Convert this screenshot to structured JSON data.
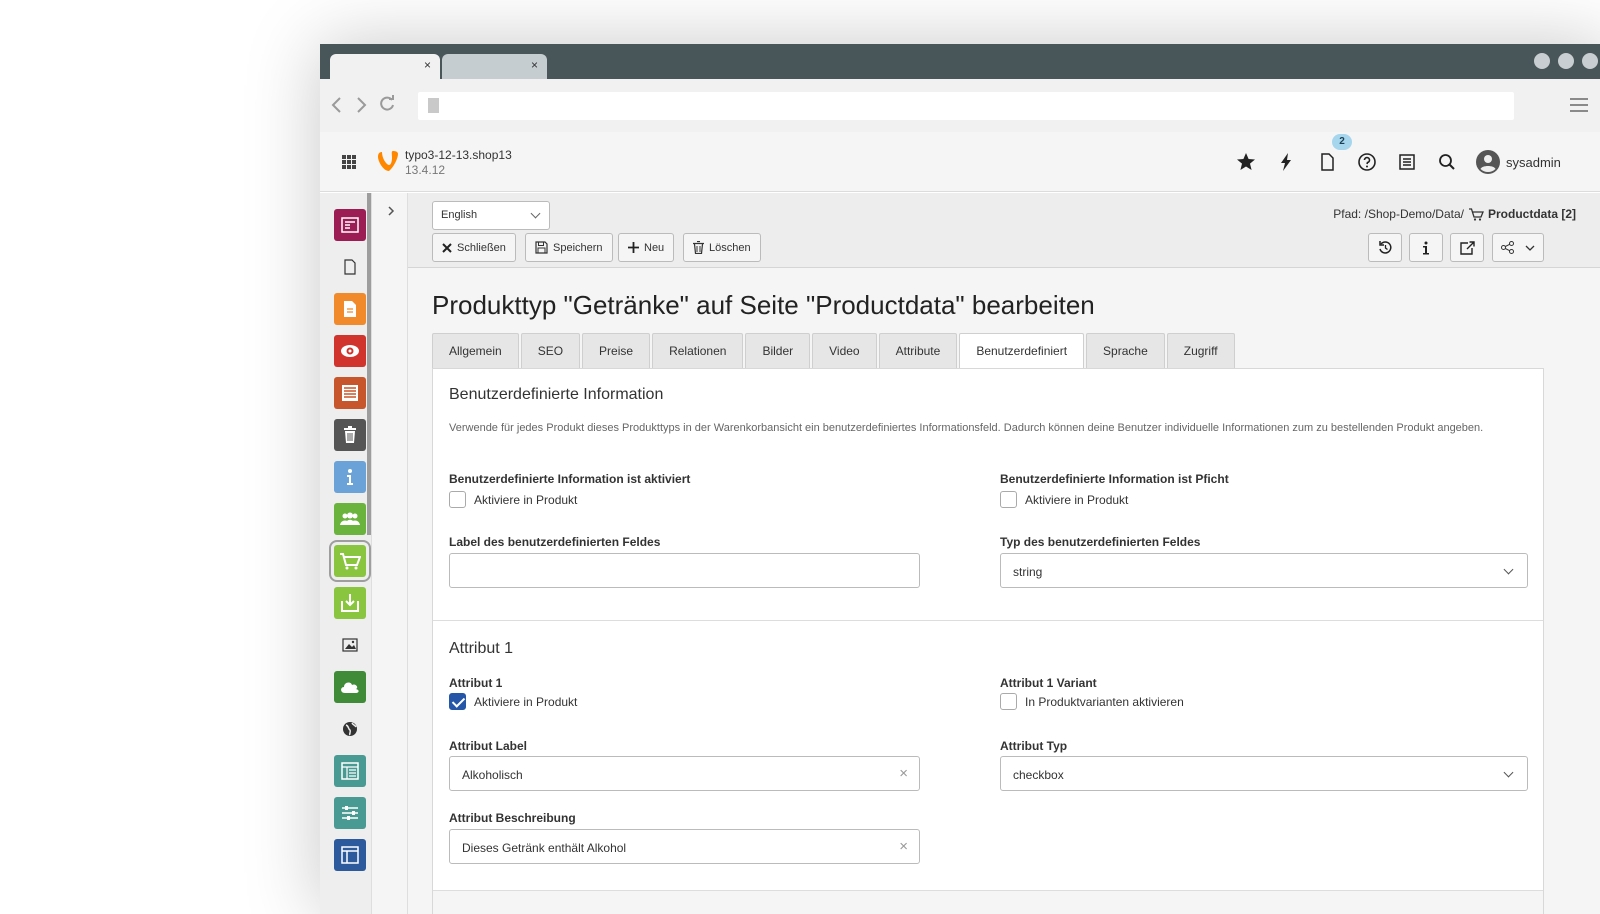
{
  "browser": {
    "tab1_close": "×",
    "tab2_close": "×"
  },
  "typo3": {
    "site_name": "typo3-12-13.shop13",
    "version": "13.4.12",
    "notification_count": "2",
    "username": "sysadmin"
  },
  "docheader": {
    "language": "English",
    "path_prefix": "Pfad: /Shop-Demo/Data/",
    "path_page": "Productdata [2]",
    "buttons": {
      "close": "Schließen",
      "save": "Speichern",
      "new": "Neu",
      "delete": "Löschen"
    }
  },
  "page_title": "Produkttyp \"Getränke\" auf Seite \"Productdata\" bearbeiten",
  "tabs": [
    "Allgemein",
    "SEO",
    "Preise",
    "Relationen",
    "Bilder",
    "Video",
    "Attribute",
    "Benutzerdefiniert",
    "Sprache",
    "Zugriff"
  ],
  "active_tab": "Benutzerdefiniert",
  "custom_section": {
    "heading": "Benutzerdefinierte Information",
    "description": "Verwende für jedes Produkt dieses Produkttyps in der Warenkorbansicht ein benutzerdefiniertes Informationsfeld. Dadurch können deine Benutzer individuelle Informationen zum zu bestellenden Produkt angeben.",
    "active_label": "Benutzerdefinierte Information ist aktiviert",
    "active_checkbox": "Aktiviere in Produkt",
    "required_label": "Benutzerdefinierte Information ist Pficht",
    "required_checkbox": "Aktiviere in Produkt",
    "field_label_label": "Label des benutzerdefinierten Feldes",
    "field_label_value": "",
    "field_type_label": "Typ des benutzerdefinierten Feldes",
    "field_type_value": "string"
  },
  "attribute_section": {
    "heading": "Attribut 1",
    "attr_label": "Attribut 1",
    "attr_checkbox": "Aktiviere in Produkt",
    "attr_checked": true,
    "variant_label": "Attribut 1 Variant",
    "variant_checkbox": "In Produktvarianten aktivieren",
    "label_label": "Attribut Label",
    "label_value": "Alkoholisch",
    "type_label": "Attribut Typ",
    "type_value": "checkbox",
    "desc_label": "Attribut Beschreibung",
    "desc_value": "Dieses Getränk enthält Alkohol"
  },
  "colors": {
    "accent_blue": "#2556a8",
    "typo3_orange": "#ff8700",
    "badge": "#a6d6ee"
  }
}
